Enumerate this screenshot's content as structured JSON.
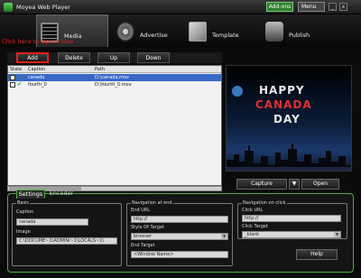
{
  "window": {
    "title": "Moyea Web Player",
    "addons_label": "Add-ons",
    "menu_label": "Menu",
    "min_label": "_",
    "close_label": "x"
  },
  "nav": {
    "tabs": [
      {
        "label": "Media"
      },
      {
        "label": "Advertise"
      },
      {
        "label": "Template"
      },
      {
        "label": "Publish"
      }
    ]
  },
  "annotation": {
    "hint": "Click here to input video"
  },
  "toolbar": {
    "add_label": "Add",
    "delete_label": "Delete",
    "up_label": "Up",
    "down_label": "Down"
  },
  "list": {
    "columns": [
      "State",
      "Caption",
      "Path"
    ],
    "rows": [
      {
        "caption": "canada",
        "path": "D:\\canada.mov",
        "selected": true
      },
      {
        "caption": "fourth_0",
        "path": "D:\\fourth_0.mov",
        "selected": false
      }
    ]
  },
  "preview": {
    "line1": "HAPPY",
    "line2": "CANADA",
    "line3": "DAY"
  },
  "preview_controls": {
    "capture_label": "Capture",
    "capture_arrow": "▼",
    "open_label": "Open"
  },
  "settings": {
    "tabs": [
      {
        "label": "Settings"
      },
      {
        "label": "Encoder"
      }
    ],
    "basic": {
      "title": "Basic",
      "caption_label": "Caption",
      "caption_value": "canada",
      "image_label": "Image",
      "image_value": "C:\\DOCUME~1\\ADMINI~1\\LOCALS~1\\"
    },
    "nav_end": {
      "title": "Navigation at end",
      "end_url_label": "End URL",
      "end_url_value": "http://",
      "style_label": "Style Of Target",
      "style_value": "browser",
      "end_target_label": "End Target",
      "end_target_value": "<Window Name>"
    },
    "nav_click": {
      "title": "Navigation on click",
      "click_url_label": "Click URL",
      "click_url_value": "http://",
      "click_target_label": "Click Target",
      "click_target_value": "_blank"
    },
    "help_label": "Help"
  },
  "colors": {
    "accent_green": "#4fae3f",
    "hint_red": "#e52020",
    "selection_blue": "#3868c8"
  }
}
